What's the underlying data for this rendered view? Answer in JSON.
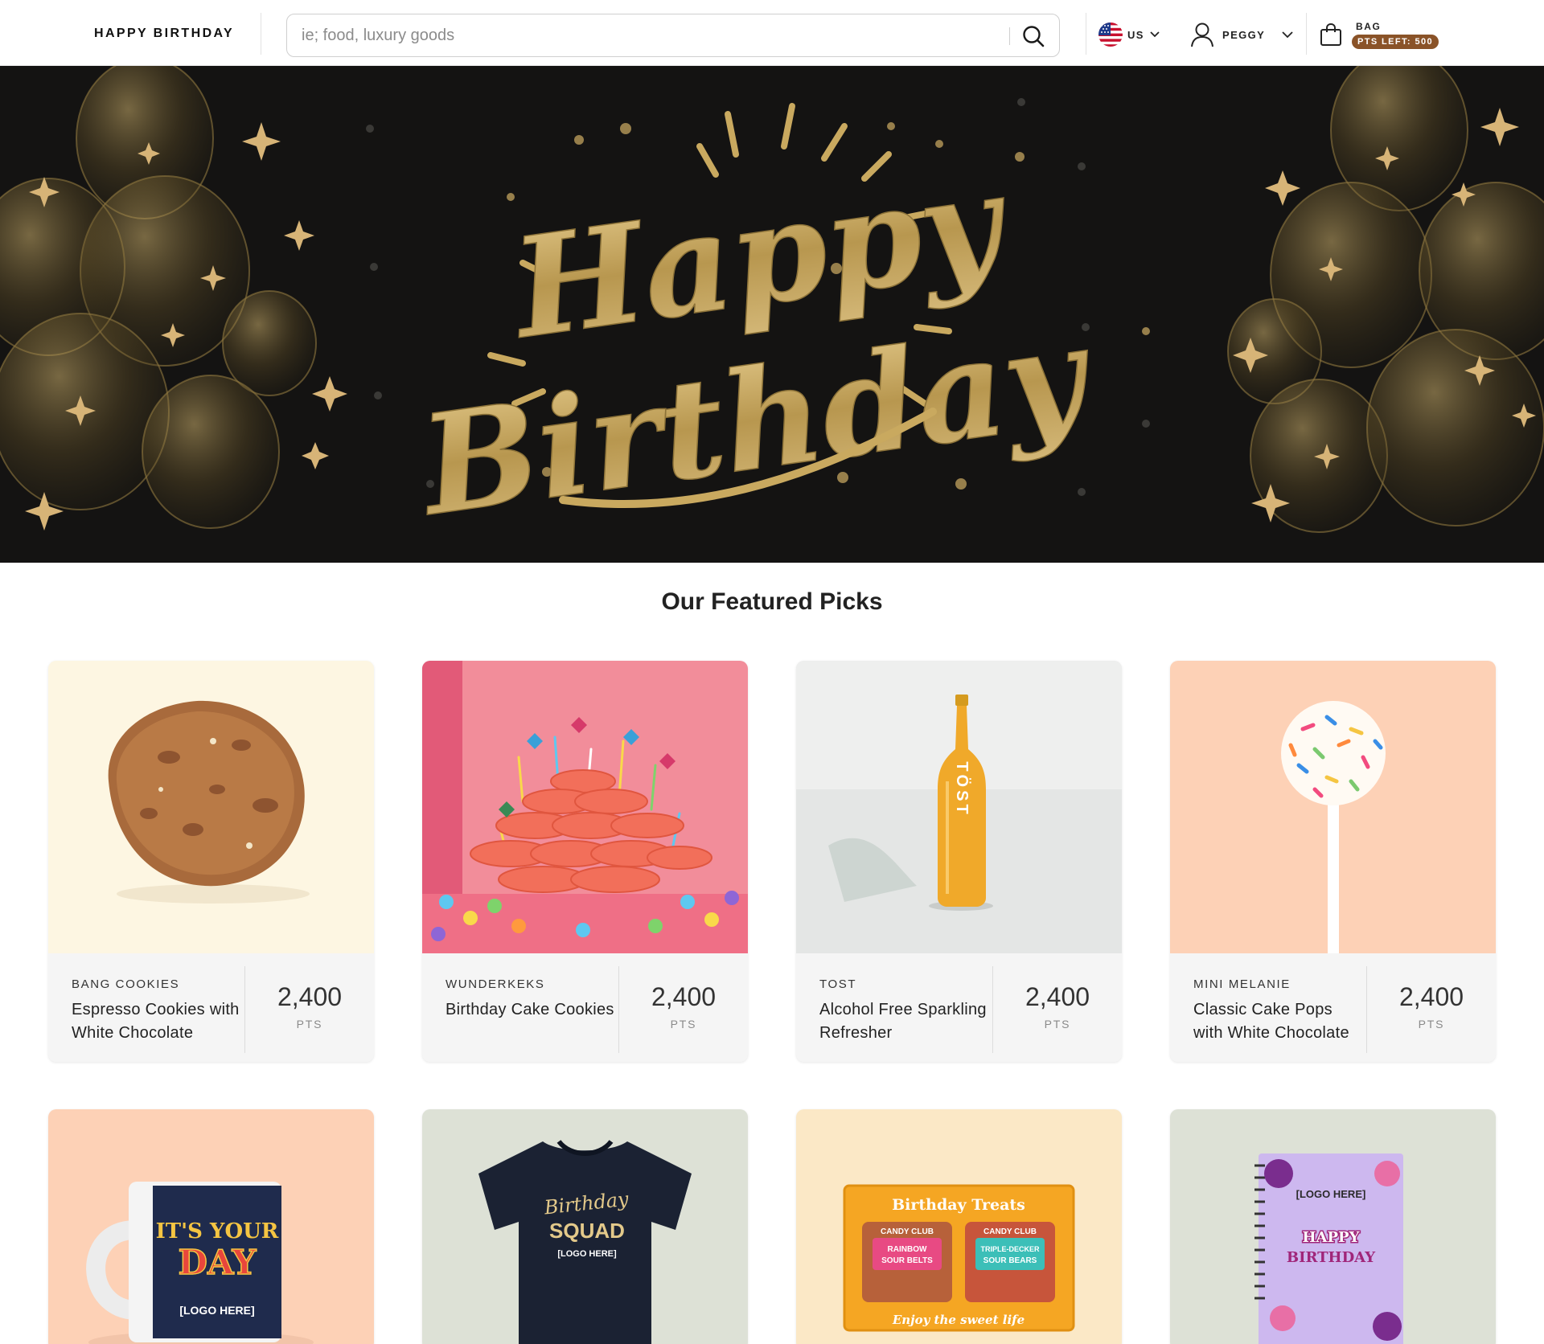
{
  "header": {
    "brand": "HAPPY BIRTHDAY",
    "search_placeholder": "ie; food, luxury goods",
    "region_label": "US",
    "user_label": "PEGGY",
    "bag_label": "BAG",
    "points_badge": "PTS LEFT: 500"
  },
  "hero": {
    "line1": "Happy",
    "line2": "Birthday"
  },
  "featured": {
    "title": "Our Featured Picks",
    "products": [
      {
        "brand": "BANG COOKIES",
        "name": "Espresso Cookies with White Chocolate",
        "price": "2,400",
        "unit": "PTS"
      },
      {
        "brand": "WUNDERKEKS",
        "name": "Birthday Cake Cookies",
        "price": "2,400",
        "unit": "PTS"
      },
      {
        "brand": "TOST",
        "name": "Alcohol Free Sparkling Refresher",
        "price": "2,400",
        "unit": "PTS"
      },
      {
        "brand": "MINI MELANIE",
        "name": "Classic Cake Pops with White Chocolate",
        "price": "2,400",
        "unit": "PTS"
      }
    ],
    "row2": [
      {
        "mug_line1": "IT'S YOUR",
        "mug_line2": "DAY",
        "mug_logo": "[LOGO HERE]"
      },
      {
        "shirt_script": "Birthday",
        "shirt_text": "SQUAD",
        "shirt_logo": "[LOGO HERE]"
      },
      {
        "box_title": "Birthday Treats",
        "box_brand_a": "CANDY CLUB",
        "box_item_a1": "RAINBOW",
        "box_item_a2": "SOUR BELTS",
        "box_brand_b": "CANDY CLUB",
        "box_item_b1": "TRIPLE-DECKER",
        "box_item_b2": "SOUR BEARS",
        "box_footer": "Enjoy the sweet life"
      },
      {
        "nb_logo": "[LOGO HERE]",
        "nb_line1": "HAPPY",
        "nb_line2": "BIRTHDAY"
      }
    ]
  },
  "bottle_label": "TÖST",
  "colors": {
    "gold": "#c9a95f",
    "hero_bg": "#141312",
    "badge": "#8a5328",
    "card_bg": "#f5f5f5"
  },
  "icons": [
    "search-icon",
    "us-flag-icon",
    "chevron-down-icon",
    "user-icon",
    "bag-icon"
  ]
}
